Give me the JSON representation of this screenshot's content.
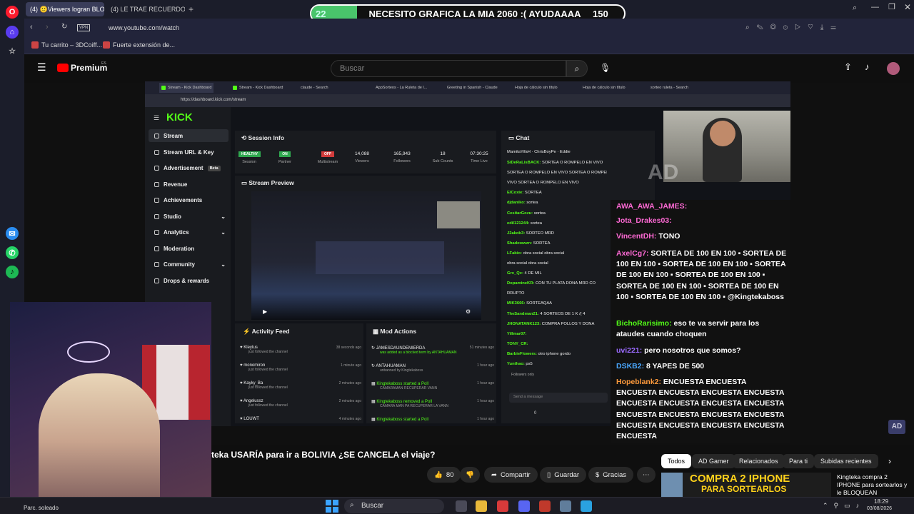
{
  "browser": {
    "tabs": [
      {
        "label": "(4) 🙂Viewers logran BLO"
      },
      {
        "label": "(4) LE TRAE RECUERDO"
      }
    ],
    "address": "www.youtube.com/watch",
    "vpn": "VPN",
    "bookmarks": [
      {
        "label": "Tu carrito – 3DCoiff..."
      },
      {
        "label": "Fuerte extensión de..."
      }
    ]
  },
  "poll": {
    "votes_left": "22",
    "question": "NECESITO GRAFICA LA MIA 2060 :( AYUDAAAA",
    "votes_right": "150"
  },
  "youtube": {
    "logo": "Premium",
    "logo_sup": "ES",
    "search_placeholder": "Buscar",
    "video_title": "teka USARÍA para ir a BOLIVIA ¿SE CANCELA el viaje?",
    "likes": "80",
    "actions": [
      "Compartir",
      "Guardar",
      "Gracias"
    ],
    "chips": [
      "Todos",
      "AD Gamer",
      "Relacionados",
      "Para ti",
      "Subidas recientes"
    ],
    "rec_thumb_text": "COMPRA 2 IPHONE",
    "rec_thumb_text2": "PARA SORTEARLOS",
    "rec_title": "Kingteka compra 2 IPHONE para sortearlos y le BLOQUEAN"
  },
  "inner": {
    "tabs": [
      "Stream - Kick Dashboard",
      "Stream - Kick Dashboard",
      "claude - Search",
      "AppSorteos - La Ruleta de l...",
      "Greeting in Spanish - Claude",
      "Hoja de cálculo sin título",
      "Hoja de cálculo sin título",
      "sorteo ruleta - Search"
    ],
    "address": "https://dashboard.kick.com/stream",
    "logo": "KICK",
    "sidebar": [
      "Stream",
      "Stream URL & Key",
      "Advertisement",
      "Revenue",
      "Achievements",
      "Studio",
      "Analytics",
      "Moderation",
      "Community",
      "Drops & rewards"
    ],
    "beta": "Beta",
    "session_title": "Session Info",
    "session_stats": [
      {
        "value": "HEALTHY",
        "label": "Session"
      },
      {
        "value": "ON",
        "label": "Partner"
      },
      {
        "value": "OFF",
        "label": "Multistream"
      },
      {
        "value": "14,088",
        "label": "Viewers"
      },
      {
        "value": "165,943",
        "label": "Followers"
      },
      {
        "value": "18",
        "label": "Sub Counts"
      },
      {
        "value": "07:30:25",
        "label": "Time Live"
      }
    ],
    "preview_title": "Stream Preview",
    "activity_title": "Activity Feed",
    "activity": [
      {
        "name": "Kleytus",
        "sub": "just followed the channel",
        "time": "38 seconds ago"
      },
      {
        "name": "monomiron",
        "sub": "just followed the channel",
        "time": "1 minute ago"
      },
      {
        "name": "Kayky_Ba",
        "sub": "just followed the channel",
        "time": "2 minutes ago"
      },
      {
        "name": "Angelussz",
        "sub": "just followed the channel",
        "time": "2 minutes ago"
      },
      {
        "name": "LOUWT",
        "sub": "",
        "time": "4 minutes ago"
      }
    ],
    "mod_title": "Mod Actions",
    "mod": [
      {
        "name": "JAMESDAUNDEMIERDA",
        "sub": "was added as a blocked term by ANTAHUAMAN",
        "time": "51 minutes ago"
      },
      {
        "name": "ANTAHUAMAN",
        "sub": "unbanned by Kingtekaboss",
        "time": "1 hour ago"
      },
      {
        "name": "Kingtekaboss started a Poll",
        "sub": "CAMARAMAN RECUPERAR VANN",
        "time": "1 hour ago"
      },
      {
        "name": "Kingtekaboss removed a Poll",
        "sub": "CAMARA MAN PA RECUPERAR LA VANN",
        "time": "1 hour ago"
      },
      {
        "name": "Kingtekaboss started a Poll",
        "sub": "",
        "time": "1 hour ago"
      }
    ],
    "chat_title": "Chat",
    "chat_top": [
      "MamitaYifaH",
      "ChrisBoyPe",
      "Eddie"
    ],
    "chat": [
      {
        "n": "SiDeRaLisBACK:",
        "m": "SORTEA O ROMPELO EN VIVO"
      },
      {
        "n": "",
        "m": "SORTEA O ROMPELO EN VIVO   SORTEA O ROMPELO EN"
      },
      {
        "n": "",
        "m": "VIVO   SORTEA O ROMPELO EN VIVO"
      },
      {
        "n": "ElCoxie:",
        "m": "SORTEA"
      },
      {
        "n": "djdaniko:",
        "m": "sortea"
      },
      {
        "n": "CesitarGozu:",
        "m": "sortea"
      },
      {
        "n": "edil121244:",
        "m": "sortea"
      },
      {
        "n": "J2akob3:",
        "m": "SORTEO MRD"
      },
      {
        "n": "Shadowwzn:",
        "m": "SORTEA"
      },
      {
        "n": "LFabio:",
        "m": "obra social   obra social"
      },
      {
        "n": "",
        "m": "obra social   obra social"
      },
      {
        "n": "Grx_Qc:",
        "m": "4 DE MIL"
      },
      {
        "n": "DopamineKR:",
        "m": "CON TU PLATA DONA MRD CO"
      },
      {
        "n": "",
        "m": "RRUPTO"
      },
      {
        "n": "MIK3666:",
        "m": "SORTEAQAA"
      },
      {
        "n": "TheSandman21:",
        "m": "4 SORTEOS DE 1 K /( 4"
      },
      {
        "n": "JHONATANK123:",
        "m": "COMPRA POLLOS Y DONA"
      },
      {
        "n": "Yillmar07:",
        "m": ""
      },
      {
        "n": "TONY_CR:",
        "m": ""
      },
      {
        "n": "BarbieFlowers:",
        "m": "otro iphone gordo"
      },
      {
        "n": "Yunthao:",
        "m": "ps5"
      }
    ],
    "followers_only": "Followers only",
    "send_placeholder": "Send a message",
    "chat_count": "0"
  },
  "overlay_chat": [
    {
      "n": "AWA_AWA_JAMES:",
      "m": "",
      "color": "#ff6ad5"
    },
    {
      "n": "Jota_Drakes03:",
      "m": "",
      "color": "#ff6ad5"
    },
    {
      "n": "VincentDH:",
      "m": " TONO",
      "color": "#ff6ad5"
    },
    {
      "n": "AxelCg7:",
      "m": " SORTEA DE 100 EN 100 ▪ SORTEA DE 100 EN 100 ▪ SORTEA DE 100 EN 100 ▪ SORTEA DE 100 EN 100 ▪ SORTEA DE 100 EN 100 ▪ SORTEA DE 100 EN 100 ▪ SORTEA DE 100 EN 100 ▪ SORTEA DE 100 EN 100 ▪ @Kingtekaboss",
      "color": "#ff6ad5"
    },
    {
      "n": "BichoRarisimo:",
      "m": " eso te va servir para los ataudes cuando choquen",
      "color": "#53fc18"
    },
    {
      "n": "uvi221:",
      "m": " pero nosotros que somos?",
      "color": "#9b6bff"
    },
    {
      "n": "DSKB2:",
      "m": " 8 YAPES DE 500",
      "color": "#4aa8ff"
    },
    {
      "n": "Hopeblank2:",
      "m": " ENCUESTA ENCUESTA ENCUESTA ENCUESTA ENCUESTA ENCUESTA ENCUESTA ENCUESTA ENCUESTA ENCUESTA ENCUESTA ENCUESTA ENCUESTA ENCUESTA ENCUESTA ENCUESTA ENCUESTA ENCUESTA ENCUESTA",
      "color": "#ff9a3c"
    }
  ],
  "taskbar": {
    "search": "Buscar",
    "weather": "Parc. soleado",
    "time": "18:29",
    "date": "03/08/2026"
  }
}
